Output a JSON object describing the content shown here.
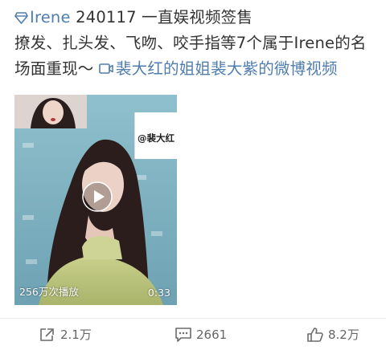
{
  "post": {
    "topic": "Irene",
    "title_rest": " 240117 一直娱视频签售",
    "line2": "撩发、扎头发、飞吻、咬手指等7个属于Irene的名场面重现～",
    "link_text": "裴大红的姐姐裴大紫的微博视频",
    "topic_icon": "diamond-icon",
    "link_icon": "video-link-icon",
    "link_color": "#507daf"
  },
  "video": {
    "watermark": "@裴大红",
    "views": "256万次播放",
    "duration": "0:33",
    "play_icon": "play-icon"
  },
  "actions": {
    "repost_count": "2.1万",
    "comment_count": "2661",
    "like_count": "8.2万",
    "repost_icon": "share-icon",
    "comment_icon": "comment-icon",
    "like_icon": "thumbs-up-icon"
  }
}
